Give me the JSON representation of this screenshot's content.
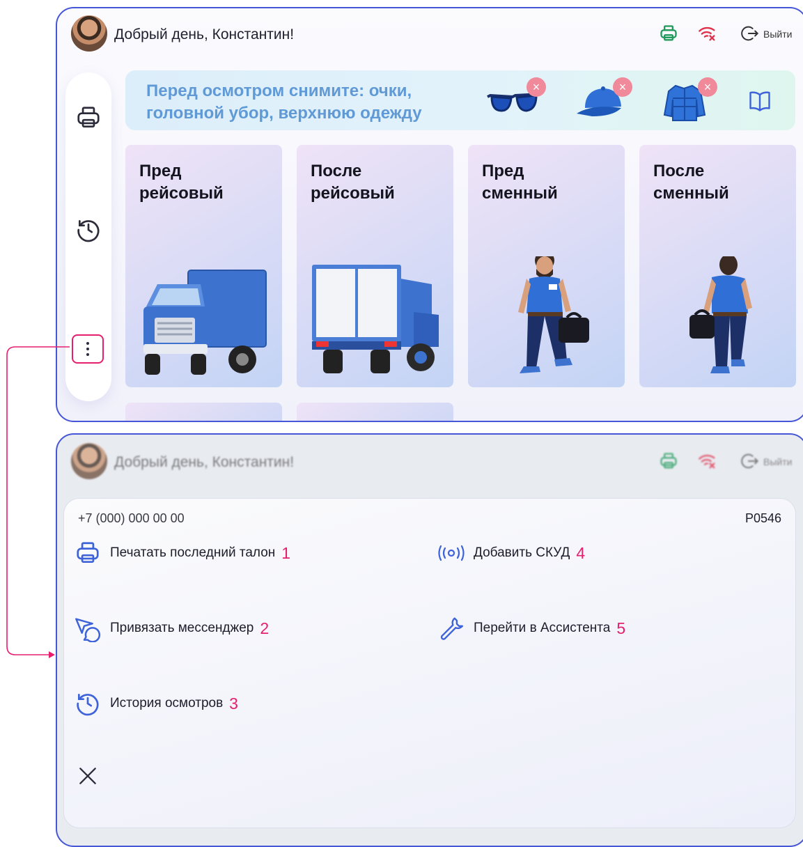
{
  "header": {
    "greeting": "Добрый день, Константин!",
    "logout_label": "Выйти",
    "icons": [
      "printer-icon",
      "wifi-off-icon",
      "logout-icon"
    ]
  },
  "banner": {
    "text": "Перед осмотром снимите: очки, головной убор, верхнюю одежду",
    "items": [
      "glasses",
      "cap",
      "jacket"
    ],
    "book_icon": "book-icon"
  },
  "sidebar": {
    "items": [
      "printer-icon",
      "history-icon",
      "more-vertical-icon"
    ]
  },
  "cards": [
    {
      "title": "Пред\nрейсовый",
      "art": "truck-front"
    },
    {
      "title": "После\nрейсовый",
      "art": "truck-back"
    },
    {
      "title": "Пред\nсменный",
      "art": "man-walking-front"
    },
    {
      "title": "После\nсменный",
      "art": "man-walking-back"
    }
  ],
  "menu": {
    "phone": "+7 (000) 000 00 00",
    "code": "P0546",
    "items": [
      {
        "label": "Печатать последний талон",
        "num": "1",
        "icon": "printer-icon"
      },
      {
        "label": "Привязать мессенджер",
        "num": "2",
        "icon": "messenger-icon"
      },
      {
        "label": "История осмотров",
        "num": "3",
        "icon": "history-icon"
      },
      {
        "label": "Добавить СКУД",
        "num": "4",
        "icon": "rfid-icon"
      },
      {
        "label": "Перейти в Ассистента",
        "num": "5",
        "icon": "wrench-icon"
      }
    ],
    "close_icon": "close-icon"
  },
  "colors": {
    "frame_border": "#4556d6",
    "accent_pink": "#e61e6e",
    "banner_text": "#5f9ad6",
    "printer_green": "#1f9a5a",
    "wifi_red": "#e0304a",
    "icon_blue": "#3e63d8"
  }
}
